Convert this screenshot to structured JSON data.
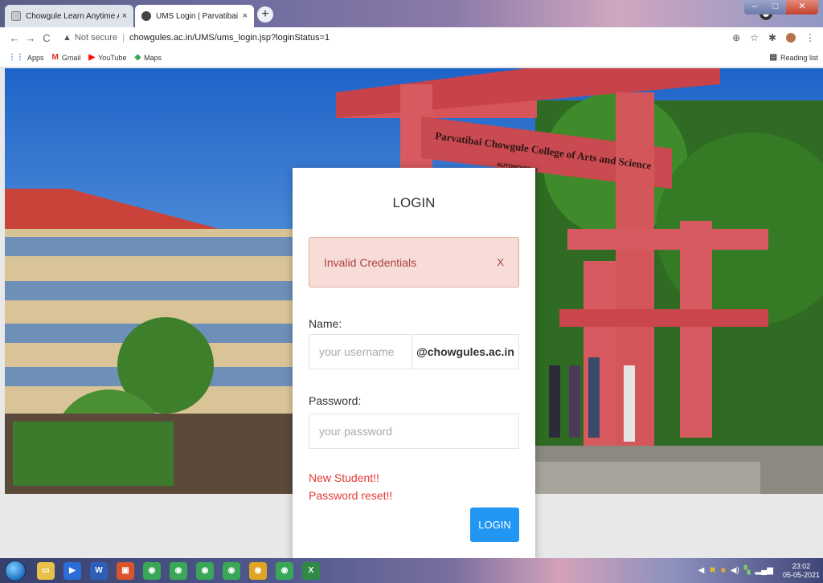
{
  "browser": {
    "tabs": [
      {
        "title": "Chowgule Learn Anytime Any Pla",
        "close": "×"
      },
      {
        "title": "UMS Login | Parvatibai Chowgul",
        "close": "×"
      }
    ],
    "new_tab": "+",
    "nav": {
      "back": "←",
      "forward": "→",
      "reload": "C"
    },
    "security": {
      "icon": "warning-icon",
      "label": "Not secure"
    },
    "url": "chowgules.ac.in/UMS/ums_login.jsp?loginStatus=1",
    "toolbar_icons": {
      "zoom": "⊕",
      "star": "☆",
      "extensions": "✱",
      "menu": "⋮"
    },
    "bookmarks": [
      {
        "label": "Apps",
        "icon": "apps-grid-icon",
        "glyph": "⋮⋮",
        "color": "#4285f4"
      },
      {
        "label": "Gmail",
        "icon": "gmail-icon",
        "glyph": "M",
        "color": "#d93025"
      },
      {
        "label": "YouTube",
        "icon": "youtube-icon",
        "glyph": "▶",
        "color": "#ff0000"
      },
      {
        "label": "Maps",
        "icon": "maps-icon",
        "glyph": "◆",
        "color": "#34a853"
      }
    ],
    "reading_list": {
      "label": "Reading list",
      "glyph": "▤"
    }
  },
  "hero": {
    "banner_text": "Parvatibai Chowgule College of Arts and Science",
    "banner_sub": "AUTONOMOUS"
  },
  "login": {
    "title": "LOGIN",
    "alert": {
      "message": "Invalid Credentials",
      "close": "X"
    },
    "name_label": "Name:",
    "username_placeholder": "your username",
    "domain_suffix": "@chowgules.ac.in",
    "password_label": "Password:",
    "password_placeholder": "your password",
    "new_student_link": "New Student!!",
    "password_reset_link": "Password reset!!",
    "button_label": "LOGIN"
  },
  "taskbar": {
    "icons": [
      {
        "name": "explorer-icon",
        "glyph": "▭",
        "color": "#e8c14a"
      },
      {
        "name": "media-icon",
        "glyph": "▶",
        "color": "#2b6cd8"
      },
      {
        "name": "word-icon",
        "glyph": "W",
        "color": "#2d5fb8"
      },
      {
        "name": "app-icon",
        "glyph": "▣",
        "color": "#d9542b"
      },
      {
        "name": "chrome-icon-1",
        "glyph": "◉",
        "color": "#3aa657"
      },
      {
        "name": "chrome-icon-2",
        "glyph": "◉",
        "color": "#3aa657"
      },
      {
        "name": "chrome-icon-3",
        "glyph": "◉",
        "color": "#3aa657"
      },
      {
        "name": "chrome-icon-4",
        "glyph": "◉",
        "color": "#3aa657"
      },
      {
        "name": "chrome-icon-5",
        "glyph": "◉",
        "color": "#e0a526"
      },
      {
        "name": "chrome-icon-6",
        "glyph": "◉",
        "color": "#3aa657"
      },
      {
        "name": "excel-icon",
        "glyph": "X",
        "color": "#2f8a45"
      }
    ],
    "clock": {
      "time": "23:02",
      "date": "05-05-2021"
    }
  }
}
